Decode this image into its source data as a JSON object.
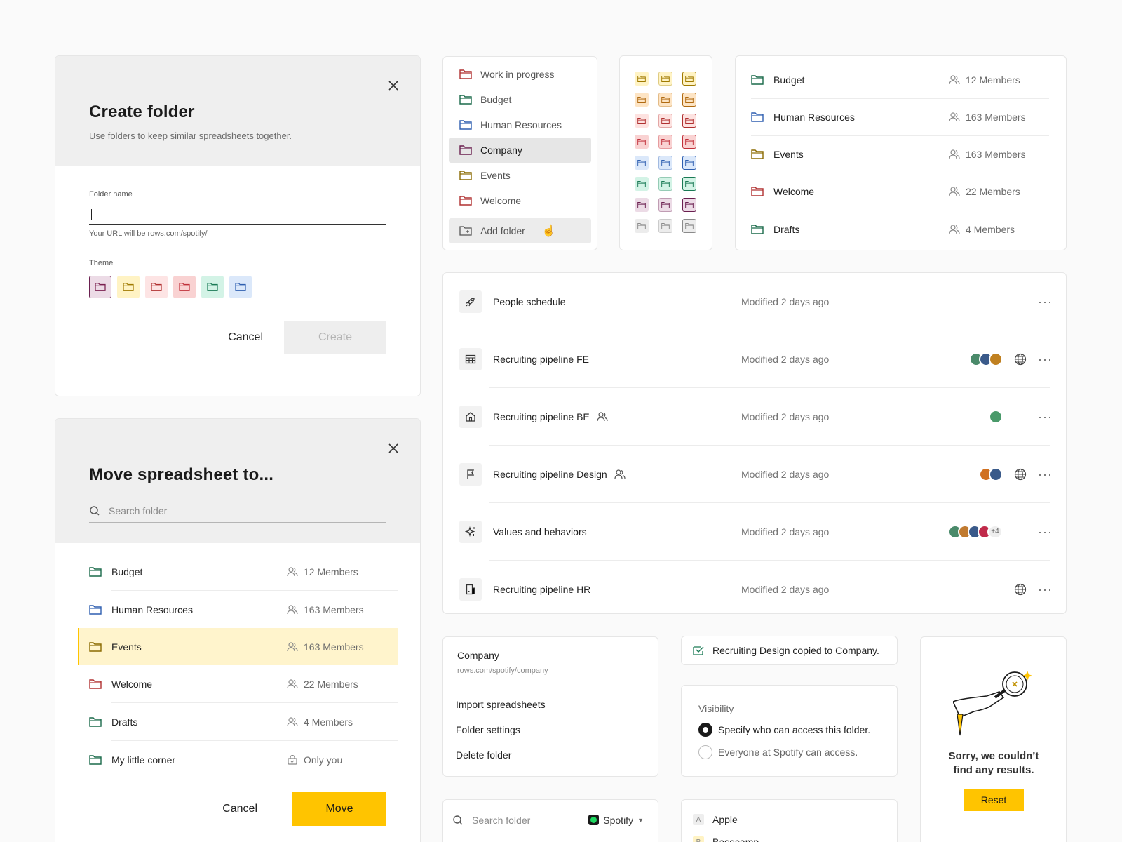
{
  "create_folder": {
    "title": "Create folder",
    "subtitle": "Use folders to keep similar spreadsheets together.",
    "field_label": "Folder name",
    "field_value": "",
    "url_hint": "Your URL will be rows.com/spotify/",
    "theme_label": "Theme",
    "themes": [
      "#7a1f4f",
      "#a07a00",
      "#b03030",
      "#c0303a",
      "#1a7a55",
      "#2f5fb0"
    ],
    "cancel_label": "Cancel",
    "create_label": "Create"
  },
  "move_sheet": {
    "title": "Move spreadsheet to...",
    "search_placeholder": "Search folder",
    "items": [
      {
        "name": "Budget",
        "members": "12 Members",
        "color": "#1a6a4a",
        "icon": "people-icon"
      },
      {
        "name": "Human Resources",
        "members": "163 Members",
        "color": "#2f5fb0",
        "icon": "people-icon"
      },
      {
        "name": "Events",
        "members": "163 Members",
        "color": "#8a6a00",
        "icon": "people-icon"
      },
      {
        "name": "Welcome",
        "members": "22 Members",
        "color": "#b03030",
        "icon": "people-icon"
      },
      {
        "name": "Drafts",
        "members": "4 Members",
        "color": "#1a6a4a",
        "icon": "people-icon"
      },
      {
        "name": "My little corner",
        "members": "Only you",
        "color": "#1a6a4a",
        "icon": "lock-icon"
      }
    ],
    "cancel_label": "Cancel",
    "move_label": "Move"
  },
  "folder_menu": {
    "items": [
      {
        "name": "Work in progress",
        "color": "#b03030"
      },
      {
        "name": "Budget",
        "color": "#1a6a4a"
      },
      {
        "name": "Human Resources",
        "color": "#2f5fb0"
      },
      {
        "name": "Company",
        "color": "#6a1f4f"
      },
      {
        "name": "Events",
        "color": "#8a6a00"
      },
      {
        "name": "Welcome",
        "color": "#b03030"
      }
    ],
    "add_label": "Add folder"
  },
  "palette": {
    "rows": [
      {
        "bg": "#fff3c4",
        "fg": "#a07a00"
      },
      {
        "bg": "#fde4c4",
        "fg": "#b06a10"
      },
      {
        "bg": "#fde2e0",
        "fg": "#b03030"
      },
      {
        "bg": "#f9d2d2",
        "fg": "#c0303a"
      },
      {
        "bg": "#dbe8fa",
        "fg": "#2f5fb0"
      },
      {
        "bg": "#d3f3e6",
        "fg": "#1a7a55"
      },
      {
        "bg": "#ecdbe6",
        "fg": "#6a1f4f"
      },
      {
        "bg": "#ececec",
        "fg": "#8a8a8a"
      }
    ]
  },
  "members_list": {
    "items": [
      {
        "name": "Budget",
        "members": "12 Members",
        "color": "#1a6a4a"
      },
      {
        "name": "Human Resources",
        "members": "163 Members",
        "color": "#2f5fb0"
      },
      {
        "name": "Events",
        "members": "163 Members",
        "color": "#8a6a00"
      },
      {
        "name": "Welcome",
        "members": "22 Members",
        "color": "#b03030"
      },
      {
        "name": "Drafts",
        "members": "4 Members",
        "color": "#1a6a4a"
      }
    ]
  },
  "sheets": {
    "items": [
      {
        "name": "People schedule",
        "modified": "Modified 2 days ago",
        "icon": "rocket-icon",
        "shared": false,
        "avatars": [],
        "extra": "",
        "globe": false
      },
      {
        "name": "Recruiting pipeline FE",
        "modified": "Modified 2 days ago",
        "icon": "table-icon",
        "shared": false,
        "avatars": [
          "#4a8a6a",
          "#3a5a8a",
          "#c08020"
        ],
        "extra": "",
        "globe": true
      },
      {
        "name": "Recruiting pipeline BE",
        "modified": "Modified 2 days ago",
        "icon": "home-icon",
        "shared": true,
        "avatars": [
          "#4a9a6a"
        ],
        "extra": "",
        "globe": false
      },
      {
        "name": "Recruiting pipeline Design",
        "modified": "Modified 2 days ago",
        "icon": "flag-icon",
        "shared": true,
        "avatars": [
          "#d07020",
          "#3a5a8a"
        ],
        "extra": "",
        "globe": true
      },
      {
        "name": "Values and behaviors",
        "modified": "Modified 2 days ago",
        "icon": "sparkle-icon",
        "shared": false,
        "avatars": [
          "#4a8a6a",
          "#c07a30",
          "#3a5a8a",
          "#c02a4a"
        ],
        "extra": "+4",
        "globe": false
      },
      {
        "name": "Recruiting pipeline HR",
        "modified": "Modified 2 days ago",
        "icon": "building-icon",
        "shared": false,
        "avatars": [],
        "extra": "",
        "globe": true
      }
    ]
  },
  "context_menu": {
    "title": "Company",
    "url": "rows.com/spotify/company",
    "items": [
      "Import spreadsheets",
      "Folder settings",
      "Delete folder"
    ]
  },
  "toast": {
    "text": "Recruiting Design copied to Company."
  },
  "visibility": {
    "label": "Visibility",
    "options": [
      "Specify who can access this folder.",
      "Everyone at Spotify can access."
    ],
    "selected": 0
  },
  "empty": {
    "text": "Sorry, we couldn’t find any results.",
    "reset_label": "Reset"
  },
  "search_bottom": {
    "placeholder": "Search folder",
    "workspace": "Spotify"
  },
  "company_list": {
    "items": [
      {
        "letter": "A",
        "name": "Apple"
      },
      {
        "letter": "B",
        "name": "Basecamp"
      }
    ]
  }
}
